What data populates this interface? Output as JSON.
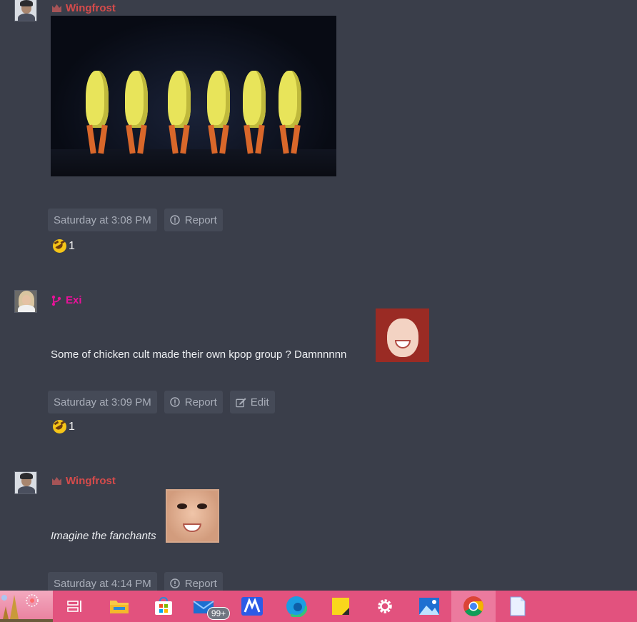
{
  "posts": [
    {
      "username": "Wingfrost",
      "timestamp": "Saturday at 3:08 PM",
      "report_label": "Report",
      "reaction_count": "1"
    },
    {
      "username": "Exi",
      "message": "Some of chicken cult made their own kpop group ? Damnnnnn",
      "timestamp": "Saturday at 3:09 PM",
      "report_label": "Report",
      "edit_label": "Edit",
      "reaction_count": "1"
    },
    {
      "username": "Wingfrost",
      "message": "Imagine the fanchants",
      "timestamp": "Saturday at 4:14 PM",
      "report_label": "Report"
    }
  ],
  "taskbar": {
    "mail_badge": "99+",
    "items": [
      "start-button",
      "task-view-icon",
      "file-explorer-icon",
      "store-icon",
      "mail-icon",
      "maxthon-icon",
      "edge-icon",
      "sticky-notes-icon",
      "settings-icon",
      "photos-icon",
      "chrome-icon",
      "notepad-icon"
    ]
  },
  "colors": {
    "background": "#3a3e4a",
    "wingfrost_name": "#d64b4b",
    "exi_name": "#e8129a",
    "action_button": "#454a57",
    "taskbar": "#e2527e"
  }
}
